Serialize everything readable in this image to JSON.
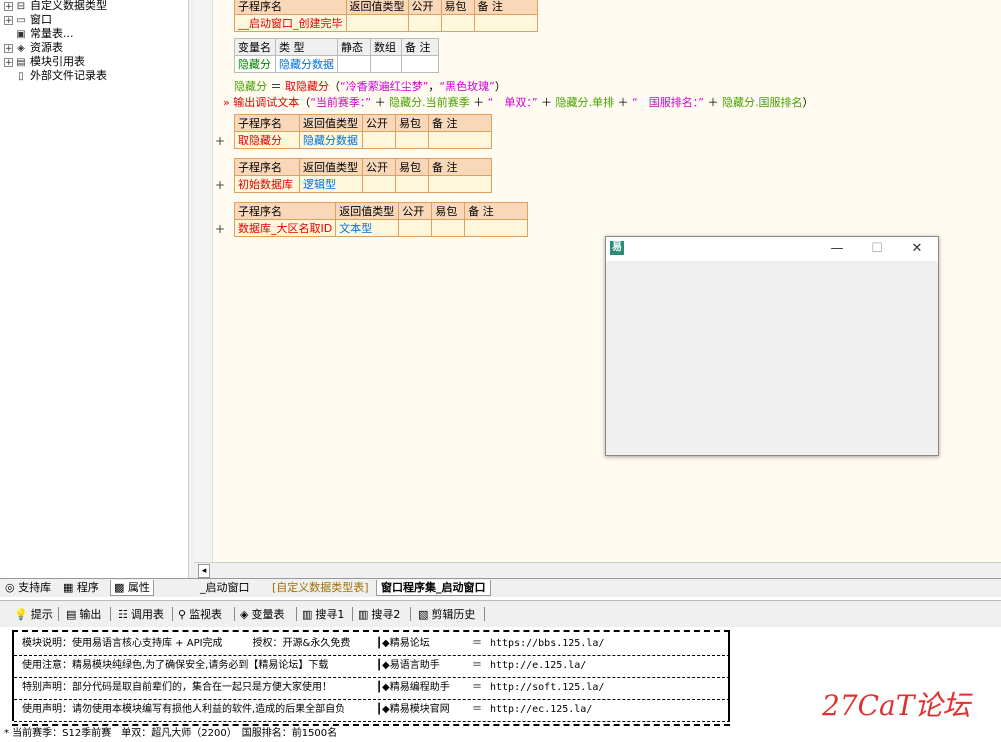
{
  "tree": {
    "items": [
      {
        "label": "自定义数据类型",
        "icon": "type-icon",
        "expandable": true
      },
      {
        "label": "窗口",
        "icon": "window-icon",
        "expandable": true
      },
      {
        "label": "常量表...",
        "icon": "constant-icon",
        "expandable": false
      },
      {
        "label": "资源表",
        "icon": "resource-icon",
        "expandable": true
      },
      {
        "label": "模块引用表",
        "icon": "module-icon",
        "expandable": true
      },
      {
        "label": "外部文件记录表",
        "icon": "file-icon",
        "expandable": false
      }
    ]
  },
  "left_tabs": [
    {
      "label": "支持库"
    },
    {
      "label": "程序"
    },
    {
      "label": "属性"
    }
  ],
  "code": {
    "sub1": {
      "headers": [
        "子程序名",
        "返回值类型",
        "公开",
        "易包",
        "备 注"
      ],
      "name": "__启动窗口_创建完毕",
      "return_type": ""
    },
    "vars": {
      "headers": [
        "变量名",
        "类 型",
        "静态",
        "数组",
        "备 注"
      ],
      "name": "隐藏分",
      "type": "隐藏分数据"
    },
    "line1": {
      "lhs": "隐藏分",
      "op": "＝",
      "fn": "取隐藏分",
      "open": "（",
      "arg1": "“冷香萦遍红尘梦”",
      "comma": "，",
      "arg2": "“黑色玫瑰”",
      "close": "）"
    },
    "line2": {
      "marker": "»",
      "fn": "输出调试文本",
      "open": "（",
      "s1": "“当前赛季：”",
      "plus": "＋",
      "f1": "隐藏分.当前赛季",
      "s2": "“　单双：”",
      "f2": "隐藏分.单排",
      "s3": "“　国服排名：”",
      "f3": "隐藏分.国服排名",
      "close": "）"
    },
    "sub2": {
      "headers": [
        "子程序名",
        "返回值类型",
        "公开",
        "易包",
        "备 注"
      ],
      "name": "取隐藏分",
      "return_type": "隐藏分数据"
    },
    "sub3": {
      "headers": [
        "子程序名",
        "返回值类型",
        "公开",
        "易包",
        "备 注"
      ],
      "name": "初始数据库",
      "return_type": "逻辑型"
    },
    "sub4": {
      "headers": [
        "子程序名",
        "返回值类型",
        "公开",
        "易包",
        "备 注"
      ],
      "name": "数据库_大区名取ID",
      "return_type": "文本型"
    },
    "plus_symbol": "+"
  },
  "code_tabs": [
    {
      "label": "_启动窗口"
    },
    {
      "label": "[自定义数据类型表]"
    },
    {
      "label": "窗口程序集_启动窗口"
    }
  ],
  "toolbar": {
    "buttons": [
      {
        "label": "提示",
        "icon": "hint-icon"
      },
      {
        "label": "输出",
        "icon": "output-icon"
      },
      {
        "label": "调用表",
        "icon": "call-table-icon"
      },
      {
        "label": "监视表",
        "icon": "watch-icon"
      },
      {
        "label": "变量表",
        "icon": "variable-icon"
      },
      {
        "label": "搜寻1",
        "icon": "search1-icon"
      },
      {
        "label": "搜寻2",
        "icon": "search2-icon"
      },
      {
        "label": "剪辑历史",
        "icon": "clip-history-icon"
      }
    ]
  },
  "output": {
    "rows": [
      {
        "left": "模块说明：使用易语言核心支持库 + API完成　　　授权：开源&永久免费",
        "mid": "┃◆精易论坛",
        "eq": "＝",
        "url": "https://bbs.125.la/"
      },
      {
        "left": "使用注意：精易模块纯绿色,为了确保安全,请务必到【精易论坛】下载",
        "mid": "┃◆易语言助手",
        "eq": "＝",
        "url": "http://e.125.la/"
      },
      {
        "left": "特别声明：部分代码是取自前辈们的，集合在一起只是方便大家使用！",
        "mid": "┃◆精易编程助手",
        "eq": "＝",
        "url": "http://soft.125.la/"
      },
      {
        "left": "使用声明：请勿使用本模块编写有损他人利益的软件,造成的后果全部自负",
        "mid": "┃◆精易模块官网",
        "eq": "＝",
        "url": "http://ec.125.la/"
      }
    ],
    "status": "* 当前赛季：S12季前赛　单双：超凡大师（2200）　国服排名：前1500名"
  },
  "watermark": "27CaT论坛",
  "float_window": {
    "logo": "易",
    "minimize": "—",
    "maximize": "☐",
    "close": "✕"
  }
}
